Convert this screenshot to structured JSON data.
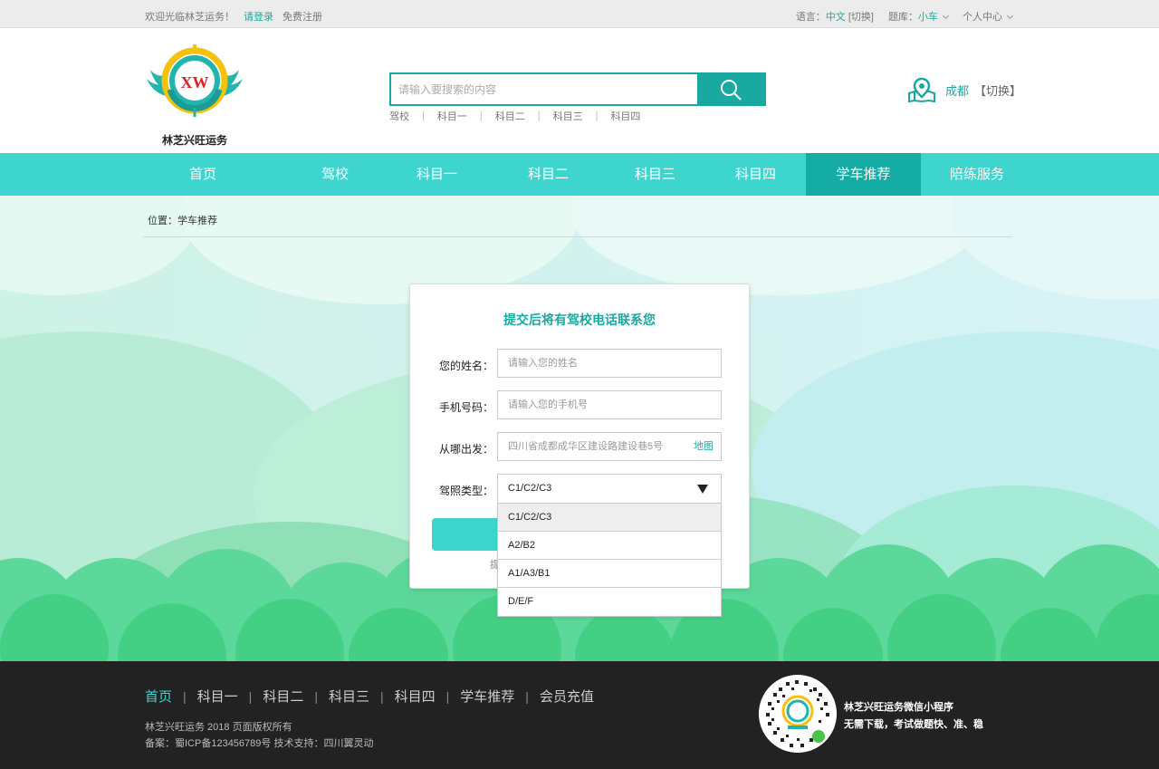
{
  "topbar": {
    "welcome": "欢迎光临林芝运务！",
    "login": "请登录",
    "register": "免费注册",
    "language_label": "语言：",
    "language_value": "中文",
    "language_switch": "[切换]",
    "bank_label": "题库：",
    "bank_value": "小车",
    "personal": "个人中心"
  },
  "header": {
    "logo_brand": "林芝兴旺运务",
    "logo_letters": "XW",
    "search_placeholder": "请输入要搜索的内容",
    "hotlinks": [
      "驾校",
      "科目一",
      "科目二",
      "科目三",
      "科目四"
    ],
    "city": "成都",
    "city_switch": "【切换】"
  },
  "nav": {
    "items": [
      "首页",
      "驾校",
      "科目一",
      "科目二",
      "科目三",
      "科目四",
      "学车推荐",
      "陪练服务"
    ],
    "active": "学车推荐"
  },
  "breadcrumb": "位置：学车推荐",
  "form": {
    "title": "提交后将有驾校电话联系您",
    "name_label": "您的姓名：",
    "name_placeholder": "请输入您的姓名",
    "phone_label": "手机号码：",
    "phone_placeholder": "请输入您的手机号",
    "from_label": "从哪出发：",
    "from_value": "四川省成都成华区建设路建设巷5号",
    "map_link": "地图",
    "license_label": "驾照类型：",
    "license_selected": "C1/C2/C3",
    "license_options": [
      "C1/C2/C3",
      "A2/B2",
      "A1/A3/B1",
      "D/E/F"
    ],
    "hint_fragment": "提"
  },
  "footer": {
    "links": [
      "首页",
      "科目一",
      "科目二",
      "科目三",
      "科目四",
      "学车推荐",
      "会员充值"
    ],
    "copyright": "林芝兴旺运务  2018  页面版权所有",
    "icp": "备案：蜀ICP备123456789号    技术支持：四川翼灵动",
    "mini_title": "林芝兴旺运务微信小程序",
    "mini_desc": "无需下载，考试做题快、准、稳"
  },
  "colors": {
    "brand_teal": "#1aa9a0",
    "nav_bg": "#3fd5cf",
    "nav_active": "#15aca6",
    "footer_bg": "#222222"
  }
}
